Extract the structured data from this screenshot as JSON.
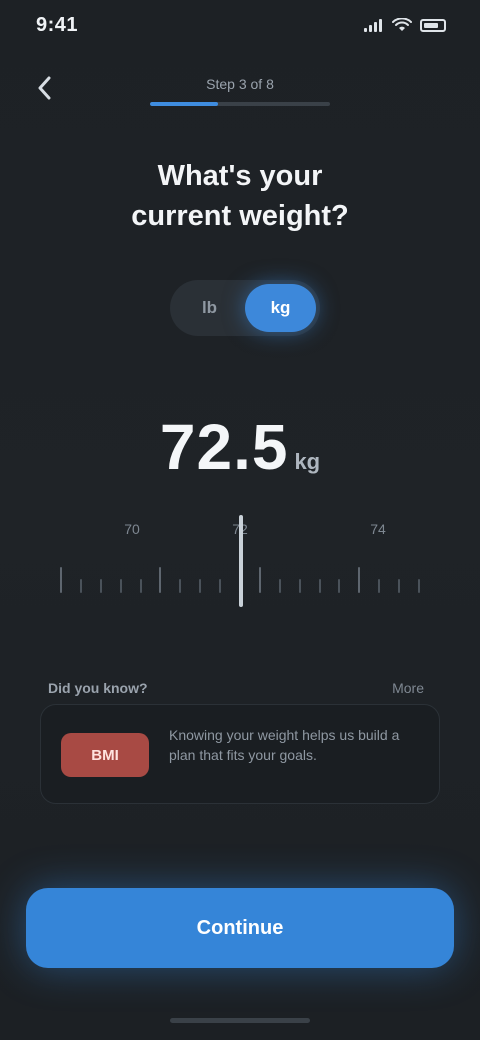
{
  "status_bar": {
    "time": "9:41"
  },
  "header": {
    "back_icon": "chevron-left-icon",
    "step_label": "Step 3 of 8",
    "progress": 0.38
  },
  "question": {
    "line1": "What's your",
    "line2": "current weight?"
  },
  "unit_toggle": {
    "options": [
      "lb",
      "kg"
    ],
    "selected": "kg"
  },
  "weight": {
    "value": "72.5",
    "unit": "kg"
  },
  "ruler": {
    "labels": [
      "70",
      "72",
      "74"
    ]
  },
  "tip": {
    "section_title": "Did you know?",
    "section_action": "More",
    "badge": "BMI",
    "text": "Knowing your weight helps us build a plan that fits your goals."
  },
  "cta": {
    "label": "Continue"
  },
  "colors": {
    "accent": "#3585d8",
    "background": "#1f2327",
    "badge": "#a84a44"
  }
}
